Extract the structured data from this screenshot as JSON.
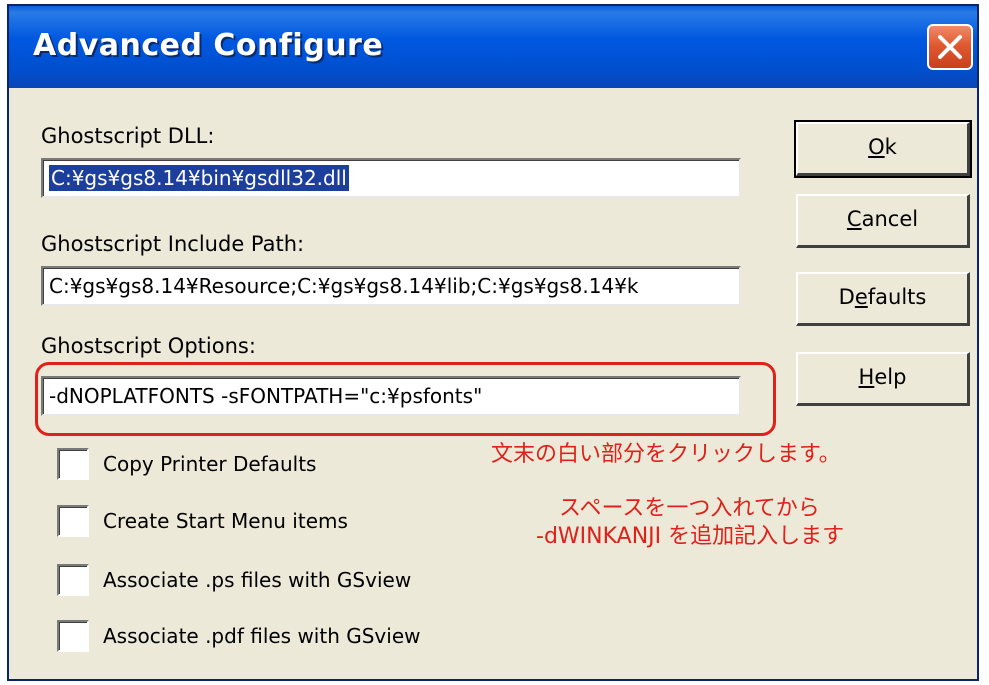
{
  "window": {
    "title": "Advanced Configure"
  },
  "icons": {
    "close": "close-icon"
  },
  "fields": {
    "dll_label": "Ghostscript DLL:",
    "dll_value": "C:¥gs¥gs8.14¥bin¥gsdll32.dll",
    "include_label": "Ghostscript Include Path:",
    "include_value": "C:¥gs¥gs8.14¥Resource;C:¥gs¥gs8.14¥lib;C:¥gs¥gs8.14¥k",
    "options_label": "Ghostscript Options:",
    "options_value": "-dNOPLATFONTS -sFONTPATH=\"c:¥psfonts\""
  },
  "buttons": {
    "ok": {
      "accel": "O",
      "rest": "k"
    },
    "cancel": {
      "accel": "C",
      "rest": "ancel"
    },
    "defaults": {
      "pre": "D",
      "accel": "e",
      "rest": "faults"
    },
    "help": {
      "accel": "H",
      "rest": "elp"
    }
  },
  "checkboxes": [
    {
      "label": "Copy Printer Defaults",
      "checked": false
    },
    {
      "label": "Create Start Menu items",
      "checked": false
    },
    {
      "label": "Associate .ps files with GSview",
      "checked": false
    },
    {
      "label": "Associate .pdf files with GSview",
      "checked": false
    }
  ],
  "annotations": {
    "line1": "文末の白い部分をクリックします。",
    "line2": "スペースを一つ入れてから",
    "line3": "-dWINKANJI を追加記入します"
  },
  "colors": {
    "titlebar": "#0058e0",
    "dialog_bg": "#ece9d8",
    "annotation": "#e0201a",
    "selection": "#1c3e9c"
  }
}
